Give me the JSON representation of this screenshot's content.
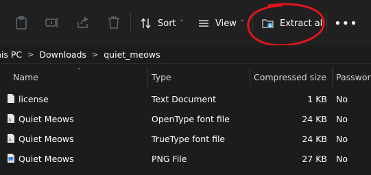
{
  "toolbar": {
    "sort_label": "Sort",
    "view_label": "View",
    "extract_label": "Extract all",
    "more_label": "•••",
    "chevron": "˅"
  },
  "breadcrumb": {
    "items": [
      "his PC",
      "Downloads",
      "quiet_meows"
    ],
    "separator": ">"
  },
  "columns": {
    "name": "Name",
    "type": "Type",
    "compressed_size": "Compressed size",
    "password": "Password"
  },
  "files": [
    {
      "icon": "text-file-icon",
      "name": "license",
      "type": "Text Document",
      "size": "1 KB",
      "password": "No"
    },
    {
      "icon": "font-file-icon",
      "name": "Quiet Meows",
      "type": "OpenType font file",
      "size": "24 KB",
      "password": "No"
    },
    {
      "icon": "font-file-icon",
      "name": "Quiet Meows",
      "type": "TrueType font file",
      "size": "24 KB",
      "password": "No"
    },
    {
      "icon": "image-file-icon",
      "name": "Quiet Meows",
      "type": "PNG File",
      "size": "27 KB",
      "password": "No"
    }
  ],
  "colors": {
    "background": "#1c1c1c",
    "toolbar": "#202020",
    "annotation_circle": "#e0161c",
    "extract_accent": "#4aa3e8"
  }
}
